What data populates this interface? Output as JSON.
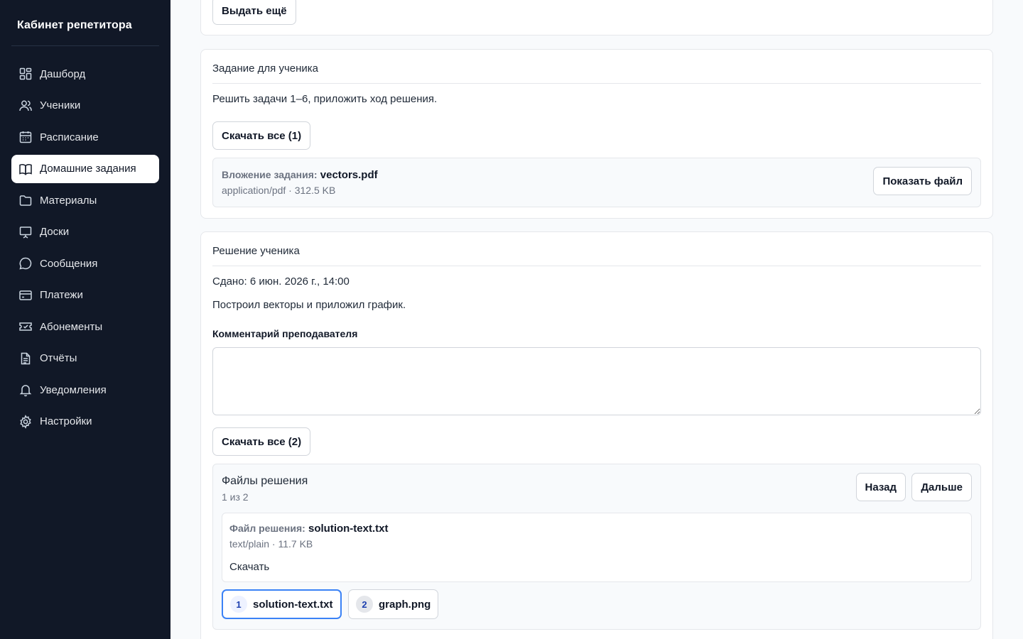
{
  "app": {
    "title": "Кабинет репетитора"
  },
  "sidebar": {
    "items": [
      {
        "label": "Дашборд",
        "icon": "dashboard-icon"
      },
      {
        "label": "Ученики",
        "icon": "users-icon"
      },
      {
        "label": "Расписание",
        "icon": "calendar-icon"
      },
      {
        "label": "Домашние задания",
        "icon": "book-icon",
        "active": true
      },
      {
        "label": "Материалы",
        "icon": "folder-icon"
      },
      {
        "label": "Доски",
        "icon": "whiteboard-icon"
      },
      {
        "label": "Сообщения",
        "icon": "chat-icon"
      },
      {
        "label": "Платежи",
        "icon": "credit-card-icon"
      },
      {
        "label": "Абонементы",
        "icon": "ticket-icon"
      },
      {
        "label": "Отчёты",
        "icon": "document-icon"
      },
      {
        "label": "Уведомления",
        "icon": "bell-icon"
      },
      {
        "label": "Настройки",
        "icon": "gear-icon"
      }
    ]
  },
  "top_card": {
    "issue_more_button": "Выдать ещё"
  },
  "assignment": {
    "title": "Задание для ученика",
    "description": "Решить задачи 1–6, приложить ход решения.",
    "download_all_button": "Скачать все (1)",
    "attachment": {
      "key_label": "Вложение задания:",
      "file_name": "vectors.pdf",
      "meta": "application/pdf · 312.5 KB",
      "show_button": "Показать файл"
    }
  },
  "solution": {
    "title": "Решение ученика",
    "submitted": "Сдано: 6 июн. 2026 г., 14:00",
    "text": "Построил векторы и приложил график.",
    "comment_label": "Комментарий преподавателя",
    "comment_value": "",
    "download_all_button": "Скачать все (2)",
    "files": {
      "title": "Файлы решения",
      "counter": "1 из 2",
      "prev_button": "Назад",
      "next_button": "Дальше",
      "current": {
        "key_label": "Файл решения:",
        "file_name": "solution-text.txt",
        "meta": "text/plain · 11.7 KB",
        "download_link": "Скачать"
      },
      "chips": [
        {
          "num": "1",
          "name": "solution-text.txt",
          "selected": true
        },
        {
          "num": "2",
          "name": "graph.png",
          "selected": false
        }
      ]
    }
  },
  "colors": {
    "sidebar_bg": "#111827",
    "accent": "#3b82f6",
    "page_bg": "#f8fafc"
  }
}
